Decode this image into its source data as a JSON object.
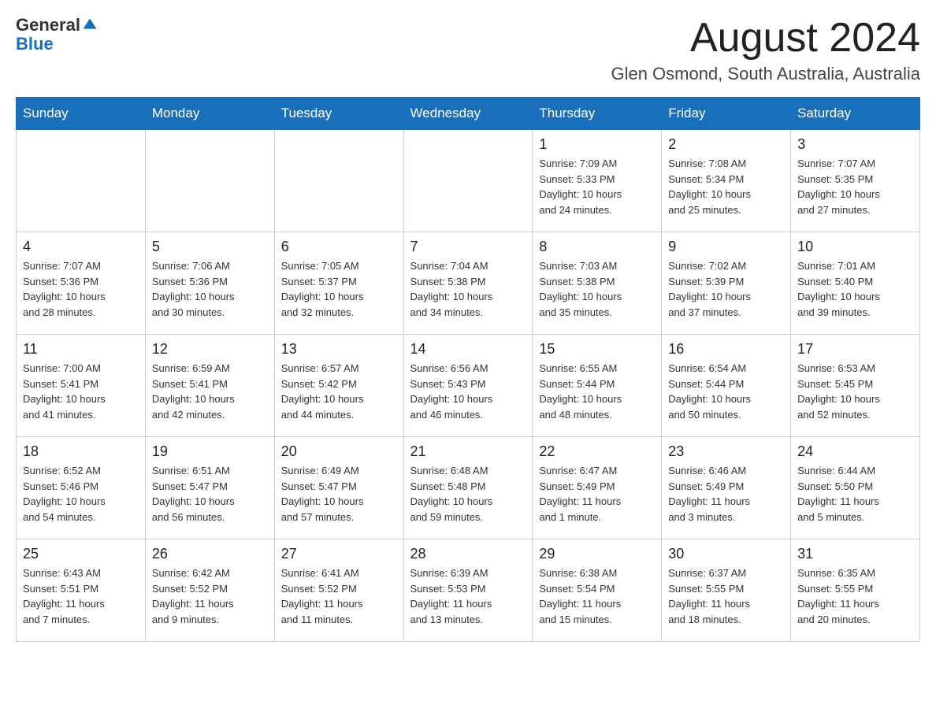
{
  "header": {
    "logo_general": "General",
    "logo_blue": "Blue",
    "month_title": "August 2024",
    "location": "Glen Osmond, South Australia, Australia"
  },
  "weekdays": [
    "Sunday",
    "Monday",
    "Tuesday",
    "Wednesday",
    "Thursday",
    "Friday",
    "Saturday"
  ],
  "weeks": [
    [
      {
        "day": "",
        "info": ""
      },
      {
        "day": "",
        "info": ""
      },
      {
        "day": "",
        "info": ""
      },
      {
        "day": "",
        "info": ""
      },
      {
        "day": "1",
        "info": "Sunrise: 7:09 AM\nSunset: 5:33 PM\nDaylight: 10 hours\nand 24 minutes."
      },
      {
        "day": "2",
        "info": "Sunrise: 7:08 AM\nSunset: 5:34 PM\nDaylight: 10 hours\nand 25 minutes."
      },
      {
        "day": "3",
        "info": "Sunrise: 7:07 AM\nSunset: 5:35 PM\nDaylight: 10 hours\nand 27 minutes."
      }
    ],
    [
      {
        "day": "4",
        "info": "Sunrise: 7:07 AM\nSunset: 5:36 PM\nDaylight: 10 hours\nand 28 minutes."
      },
      {
        "day": "5",
        "info": "Sunrise: 7:06 AM\nSunset: 5:36 PM\nDaylight: 10 hours\nand 30 minutes."
      },
      {
        "day": "6",
        "info": "Sunrise: 7:05 AM\nSunset: 5:37 PM\nDaylight: 10 hours\nand 32 minutes."
      },
      {
        "day": "7",
        "info": "Sunrise: 7:04 AM\nSunset: 5:38 PM\nDaylight: 10 hours\nand 34 minutes."
      },
      {
        "day": "8",
        "info": "Sunrise: 7:03 AM\nSunset: 5:38 PM\nDaylight: 10 hours\nand 35 minutes."
      },
      {
        "day": "9",
        "info": "Sunrise: 7:02 AM\nSunset: 5:39 PM\nDaylight: 10 hours\nand 37 minutes."
      },
      {
        "day": "10",
        "info": "Sunrise: 7:01 AM\nSunset: 5:40 PM\nDaylight: 10 hours\nand 39 minutes."
      }
    ],
    [
      {
        "day": "11",
        "info": "Sunrise: 7:00 AM\nSunset: 5:41 PM\nDaylight: 10 hours\nand 41 minutes."
      },
      {
        "day": "12",
        "info": "Sunrise: 6:59 AM\nSunset: 5:41 PM\nDaylight: 10 hours\nand 42 minutes."
      },
      {
        "day": "13",
        "info": "Sunrise: 6:57 AM\nSunset: 5:42 PM\nDaylight: 10 hours\nand 44 minutes."
      },
      {
        "day": "14",
        "info": "Sunrise: 6:56 AM\nSunset: 5:43 PM\nDaylight: 10 hours\nand 46 minutes."
      },
      {
        "day": "15",
        "info": "Sunrise: 6:55 AM\nSunset: 5:44 PM\nDaylight: 10 hours\nand 48 minutes."
      },
      {
        "day": "16",
        "info": "Sunrise: 6:54 AM\nSunset: 5:44 PM\nDaylight: 10 hours\nand 50 minutes."
      },
      {
        "day": "17",
        "info": "Sunrise: 6:53 AM\nSunset: 5:45 PM\nDaylight: 10 hours\nand 52 minutes."
      }
    ],
    [
      {
        "day": "18",
        "info": "Sunrise: 6:52 AM\nSunset: 5:46 PM\nDaylight: 10 hours\nand 54 minutes."
      },
      {
        "day": "19",
        "info": "Sunrise: 6:51 AM\nSunset: 5:47 PM\nDaylight: 10 hours\nand 56 minutes."
      },
      {
        "day": "20",
        "info": "Sunrise: 6:49 AM\nSunset: 5:47 PM\nDaylight: 10 hours\nand 57 minutes."
      },
      {
        "day": "21",
        "info": "Sunrise: 6:48 AM\nSunset: 5:48 PM\nDaylight: 10 hours\nand 59 minutes."
      },
      {
        "day": "22",
        "info": "Sunrise: 6:47 AM\nSunset: 5:49 PM\nDaylight: 11 hours\nand 1 minute."
      },
      {
        "day": "23",
        "info": "Sunrise: 6:46 AM\nSunset: 5:49 PM\nDaylight: 11 hours\nand 3 minutes."
      },
      {
        "day": "24",
        "info": "Sunrise: 6:44 AM\nSunset: 5:50 PM\nDaylight: 11 hours\nand 5 minutes."
      }
    ],
    [
      {
        "day": "25",
        "info": "Sunrise: 6:43 AM\nSunset: 5:51 PM\nDaylight: 11 hours\nand 7 minutes."
      },
      {
        "day": "26",
        "info": "Sunrise: 6:42 AM\nSunset: 5:52 PM\nDaylight: 11 hours\nand 9 minutes."
      },
      {
        "day": "27",
        "info": "Sunrise: 6:41 AM\nSunset: 5:52 PM\nDaylight: 11 hours\nand 11 minutes."
      },
      {
        "day": "28",
        "info": "Sunrise: 6:39 AM\nSunset: 5:53 PM\nDaylight: 11 hours\nand 13 minutes."
      },
      {
        "day": "29",
        "info": "Sunrise: 6:38 AM\nSunset: 5:54 PM\nDaylight: 11 hours\nand 15 minutes."
      },
      {
        "day": "30",
        "info": "Sunrise: 6:37 AM\nSunset: 5:55 PM\nDaylight: 11 hours\nand 18 minutes."
      },
      {
        "day": "31",
        "info": "Sunrise: 6:35 AM\nSunset: 5:55 PM\nDaylight: 11 hours\nand 20 minutes."
      }
    ]
  ]
}
